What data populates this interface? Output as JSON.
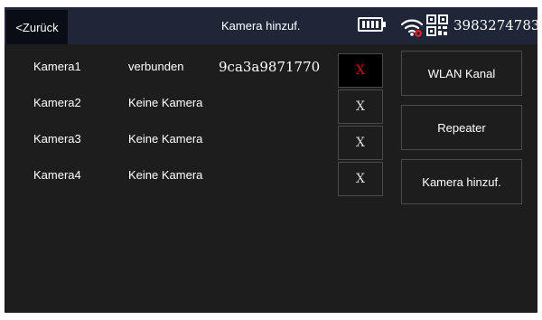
{
  "header": {
    "back_label": "<Zurück",
    "title": "Kamera hinzuf.",
    "device_id": "3983274783",
    "icons": [
      "battery-icon",
      "wifi-icon",
      "qr-code-icon"
    ],
    "wifi_alert_color": "#e02020"
  },
  "cameras": [
    {
      "name": "Kamera1",
      "status": "verbunden",
      "id": "9ca3a9871770",
      "remove_label": "X",
      "remove_active": true
    },
    {
      "name": "Kamera2",
      "status": "Keine Kamera",
      "id": "",
      "remove_label": "X",
      "remove_active": false
    },
    {
      "name": "Kamera3",
      "status": "Keine Kamera",
      "id": "",
      "remove_label": "X",
      "remove_active": false
    },
    {
      "name": "Kamera4",
      "status": "Keine Kamera",
      "id": "",
      "remove_label": "X",
      "remove_active": false
    }
  ],
  "side_buttons": {
    "wlan_label": "WLAN Kanal",
    "repeater_label": "Repeater",
    "add_camera_label": "Kamera hinzuf."
  },
  "colors": {
    "header_bg": "#1f2638",
    "screen_bg": "#1d1d1d",
    "active_x": "#cc1111"
  }
}
